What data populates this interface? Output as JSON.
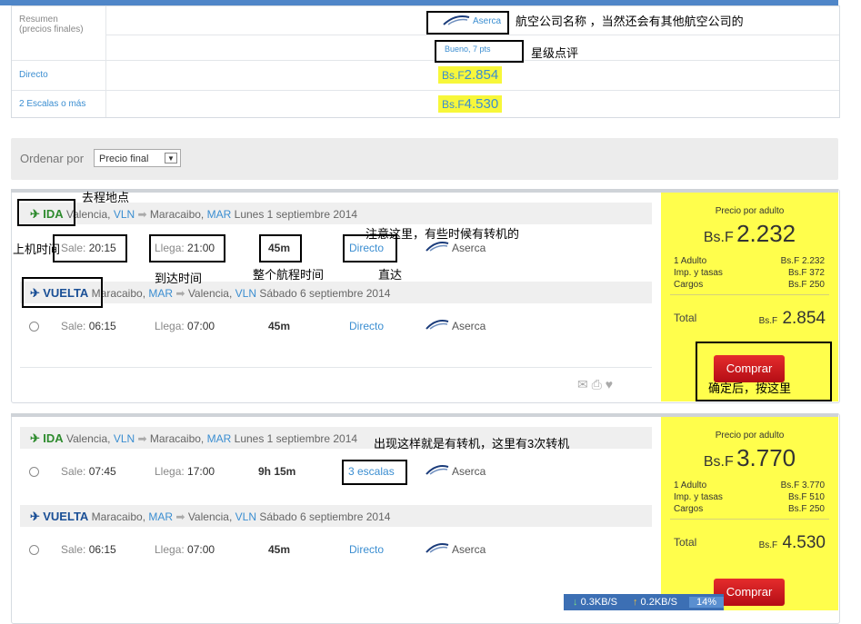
{
  "summary": {
    "label": "Resumen\n(precios finales)",
    "label_line1": "Resumen",
    "label_line2": "(precios finales)",
    "airline": "Aserca",
    "rating": "Bueno, 7 pts",
    "rows": [
      {
        "label": "Directo",
        "currency": "Bs.F",
        "price": "2.854"
      },
      {
        "label": "2 Escalas o más",
        "currency": "Bs.F",
        "price": "4.530"
      }
    ]
  },
  "sort": {
    "label": "Ordenar por",
    "selected": "Precio final"
  },
  "results": [
    {
      "ida": {
        "tag": "IDA",
        "from_city": "Valencia,",
        "from_code": "VLN",
        "to_city": "Maracaibo,",
        "to_code": "MAR",
        "date": "Lunes 1 septiembre 2014",
        "sale_lbl": "Sale:",
        "sale": "20:15",
        "llega_lbl": "Llega:",
        "llega": "21:00",
        "duration": "45m",
        "stops": "Directo",
        "airline": "Aserca"
      },
      "vuelta": {
        "tag": "VUELTA",
        "from_city": "Maracaibo,",
        "from_code": "MAR",
        "to_city": "Valencia,",
        "to_code": "VLN",
        "date": "Sábado 6 septiembre 2014",
        "sale_lbl": "Sale:",
        "sale": "06:15",
        "llega_lbl": "Llega:",
        "llega": "07:00",
        "duration": "45m",
        "stops": "Directo",
        "airline": "Aserca"
      },
      "price": {
        "per_adult_lbl": "Precio por adulto",
        "currency": "Bs.F",
        "per_adult": "2.232",
        "lines": [
          {
            "label": "1 Adulto",
            "value": "Bs.F 2.232"
          },
          {
            "label": "Imp. y tasas",
            "value": "Bs.F 372"
          },
          {
            "label": "Cargos",
            "value": "Bs.F 250"
          }
        ],
        "total_lbl": "Total",
        "total": "2.854",
        "buy": "Comprar"
      }
    },
    {
      "ida": {
        "tag": "IDA",
        "from_city": "Valencia,",
        "from_code": "VLN",
        "to_city": "Maracaibo,",
        "to_code": "MAR",
        "date": "Lunes 1 septiembre 2014",
        "sale_lbl": "Sale:",
        "sale": "07:45",
        "llega_lbl": "Llega:",
        "llega": "17:00",
        "duration": "9h 15m",
        "stops": "3 escalas",
        "airline": "Aserca"
      },
      "vuelta": {
        "tag": "VUELTA",
        "from_city": "Maracaibo,",
        "from_code": "MAR",
        "to_city": "Valencia,",
        "to_code": "VLN",
        "date": "Sábado 6 septiembre 2014",
        "sale_lbl": "Sale:",
        "sale": "06:15",
        "llega_lbl": "Llega:",
        "llega": "07:00",
        "duration": "45m",
        "stops": "Directo",
        "airline": "Aserca"
      },
      "price": {
        "per_adult_lbl": "Precio por adulto",
        "currency": "Bs.F",
        "per_adult": "3.770",
        "lines": [
          {
            "label": "1 Adulto",
            "value": "Bs.F 3.770"
          },
          {
            "label": "Imp. y tasas",
            "value": "Bs.F 510"
          },
          {
            "label": "Cargos",
            "value": "Bs.F 250"
          }
        ],
        "total_lbl": "Total",
        "total": "4.530",
        "buy": "Comprar"
      }
    }
  ],
  "notes": {
    "airline_name": "航空公司名称 ，当然还会有其他航空公司的",
    "rating": "星级点评",
    "destination": "去程地点",
    "board_time": "上机时间",
    "arrival_time": "到达时间",
    "flight_time": "整个航程时间",
    "direct": "直达",
    "transfer_note": "注意这里，有些时候有转机的",
    "confirm": "确定后，按这里",
    "stops_note": "出现这样就是有转机，这里有3次转机"
  },
  "status_bar": {
    "down": "0.3KB/S",
    "up": "0.2KB/S",
    "percent": "14%"
  },
  "colors": {
    "link": "#3b8ed1",
    "ida": "#2e8b2e",
    "vuelta": "#1a4f96",
    "price_panel": "#fffe4c",
    "highlight": "#f7f73a",
    "buy": "#c9121b"
  }
}
